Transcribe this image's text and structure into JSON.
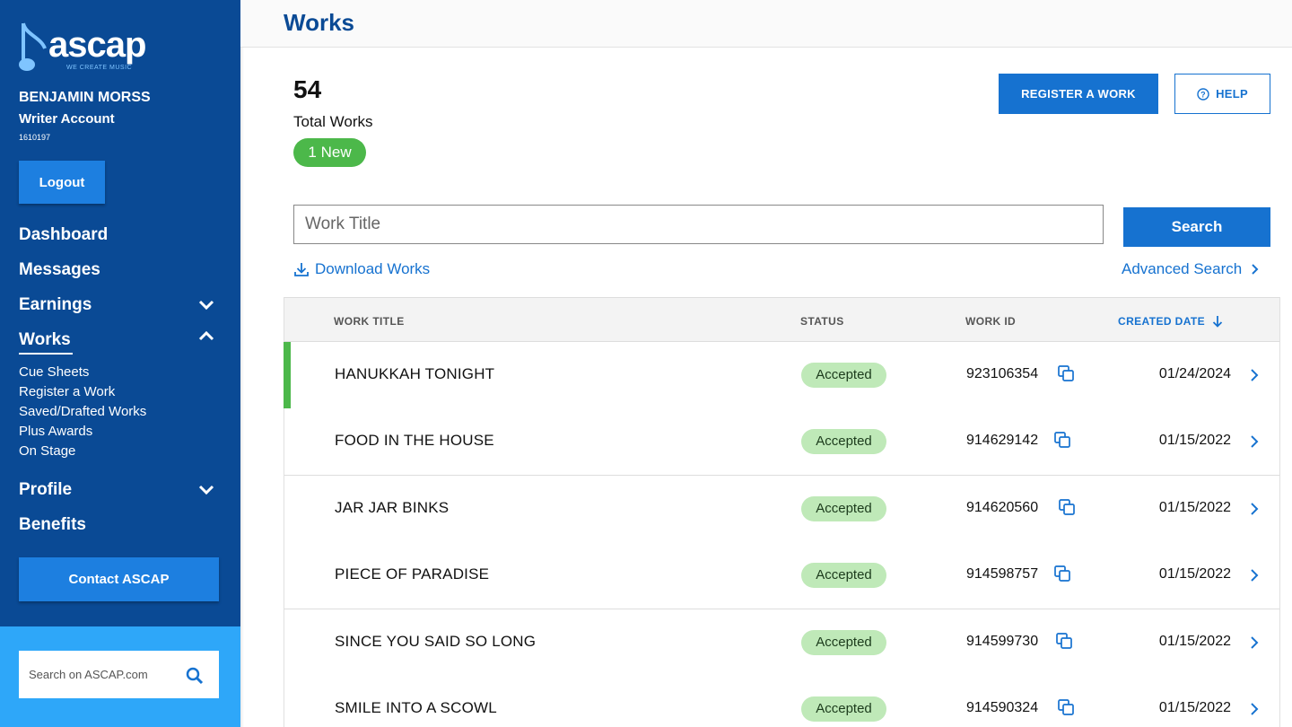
{
  "brand": {
    "name": "ascap",
    "tagline": "WE CREATE MUSIC"
  },
  "user": {
    "name": "BENJAMIN MORSS",
    "account_type": "Writer Account",
    "account_id": "1610197"
  },
  "sidebar": {
    "logout_label": "Logout",
    "nav": [
      {
        "label": "Dashboard"
      },
      {
        "label": "Messages"
      },
      {
        "label": "Earnings",
        "expandable": true,
        "expanded": false
      },
      {
        "label": "Works",
        "expandable": true,
        "expanded": true,
        "active": true
      },
      {
        "label": "Profile",
        "expandable": true,
        "expanded": false
      },
      {
        "label": "Benefits"
      }
    ],
    "works_subnav": [
      "Cue Sheets",
      "Register a Work",
      "Saved/Drafted Works",
      "Plus Awards",
      "On Stage"
    ],
    "contact_label": "Contact ASCAP",
    "search_placeholder": "Search on ASCAP.com"
  },
  "header": {
    "title": "Works"
  },
  "summary": {
    "total": "54",
    "total_label": "Total Works",
    "new_badge": "1 New"
  },
  "actions": {
    "register_label": "REGISTER A WORK",
    "help_label": "HELP"
  },
  "search": {
    "placeholder": "Work Title",
    "button_label": "Search"
  },
  "links": {
    "download": "Download Works",
    "advanced": "Advanced Search"
  },
  "table": {
    "columns": [
      "WORK TITLE",
      "STATUS",
      "WORK ID",
      "CREATED DATE"
    ],
    "sorted_column": "CREATED DATE",
    "rows": [
      {
        "title": "HANUKKAH TONIGHT",
        "status": "Accepted",
        "work_id": "923106354",
        "created": "01/24/2024",
        "is_new": true
      },
      {
        "title": "FOOD IN THE HOUSE",
        "status": "Accepted",
        "work_id": "914629142",
        "created": "01/15/2022",
        "is_new": false
      },
      {
        "title": "JAR JAR BINKS",
        "status": "Accepted",
        "work_id": "914620560",
        "created": "01/15/2022",
        "is_new": false
      },
      {
        "title": "PIECE OF PARADISE",
        "status": "Accepted",
        "work_id": "914598757",
        "created": "01/15/2022",
        "is_new": false
      },
      {
        "title": "SINCE YOU SAID SO LONG",
        "status": "Accepted",
        "work_id": "914599730",
        "created": "01/15/2022",
        "is_new": false
      },
      {
        "title": "SMILE INTO A SCOWL",
        "status": "Accepted",
        "work_id": "914590324",
        "created": "01/15/2022",
        "is_new": false
      }
    ]
  },
  "colors": {
    "sidebar": "#0a4a95",
    "accent": "#1672d0",
    "new_green": "#4cb84a",
    "status_bg": "#bfe9b8",
    "sidebar_search_bg": "#2ea7f9"
  }
}
